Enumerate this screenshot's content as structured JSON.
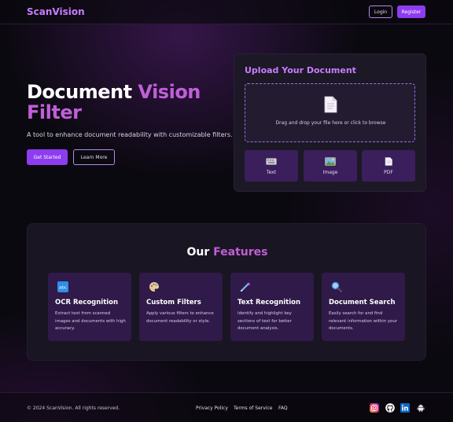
{
  "nav": {
    "brand": "ScanVision",
    "login": "Login",
    "register": "Register"
  },
  "hero": {
    "title_plain": "Document ",
    "title_highlight": "Vision",
    "title_line2": "Filter",
    "subtitle": "A tool to enhance document readability with customizable filters.",
    "primary_button": "Get Started",
    "secondary_button": "Learn More"
  },
  "upload": {
    "title": "Upload Your Document",
    "drop_text": "Drag and drop your file here or click to browse",
    "types": [
      {
        "label": "Text",
        "icon": "keyboard-icon"
      },
      {
        "label": "Image",
        "icon": "image-icon"
      },
      {
        "label": "PDF",
        "icon": "document-icon"
      }
    ]
  },
  "features": {
    "title_plain": "Our ",
    "title_highlight": "Features",
    "cards": [
      {
        "title": "OCR Recognition",
        "desc": "Extract text from scanned images and documents with high accuracy.",
        "icon": "abc-icon"
      },
      {
        "title": "Custom Filters",
        "desc": "Apply various filters to enhance document readability or style.",
        "icon": "palette-icon"
      },
      {
        "title": "Text Recognition",
        "desc": "Identify and highlight key sections of text for better document analysis.",
        "icon": "pen-icon"
      },
      {
        "title": "Document Search",
        "desc": "Easily search for and find relevant information within your documents.",
        "icon": "magnifier-icon"
      }
    ]
  },
  "footer": {
    "copyright": "© 2024 ScanVision. All rights reserved.",
    "links": [
      "Privacy Policy",
      "Terms of Service",
      "FAQ"
    ],
    "social": [
      "instagram-icon",
      "github-icon",
      "linkedin-icon",
      "android-icon"
    ]
  },
  "colors": {
    "accent": "#8e3cf0",
    "brand": "#c77dff",
    "highlight": "#c05fd8",
    "card": "#2f1a4a"
  }
}
